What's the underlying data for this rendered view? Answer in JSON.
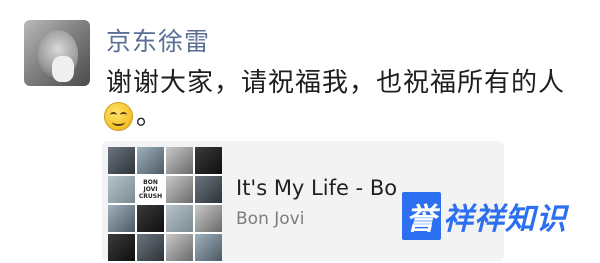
{
  "post": {
    "author": "京东徐雷",
    "message": "谢谢大家，请祝福我，也祝福所有的人",
    "emoji_icon": "smiling-face-icon",
    "tail": "。"
  },
  "music_card": {
    "title": "It's My Life - Bo",
    "artist": "Bon Jovi",
    "cover_text": [
      "BON",
      "JOVI",
      "CRUSH"
    ]
  },
  "watermark": {
    "boxed": "誉",
    "rest": "祥祥知识"
  },
  "colors": {
    "name": "#5a6f95",
    "watermark": "#2c6ff0"
  }
}
